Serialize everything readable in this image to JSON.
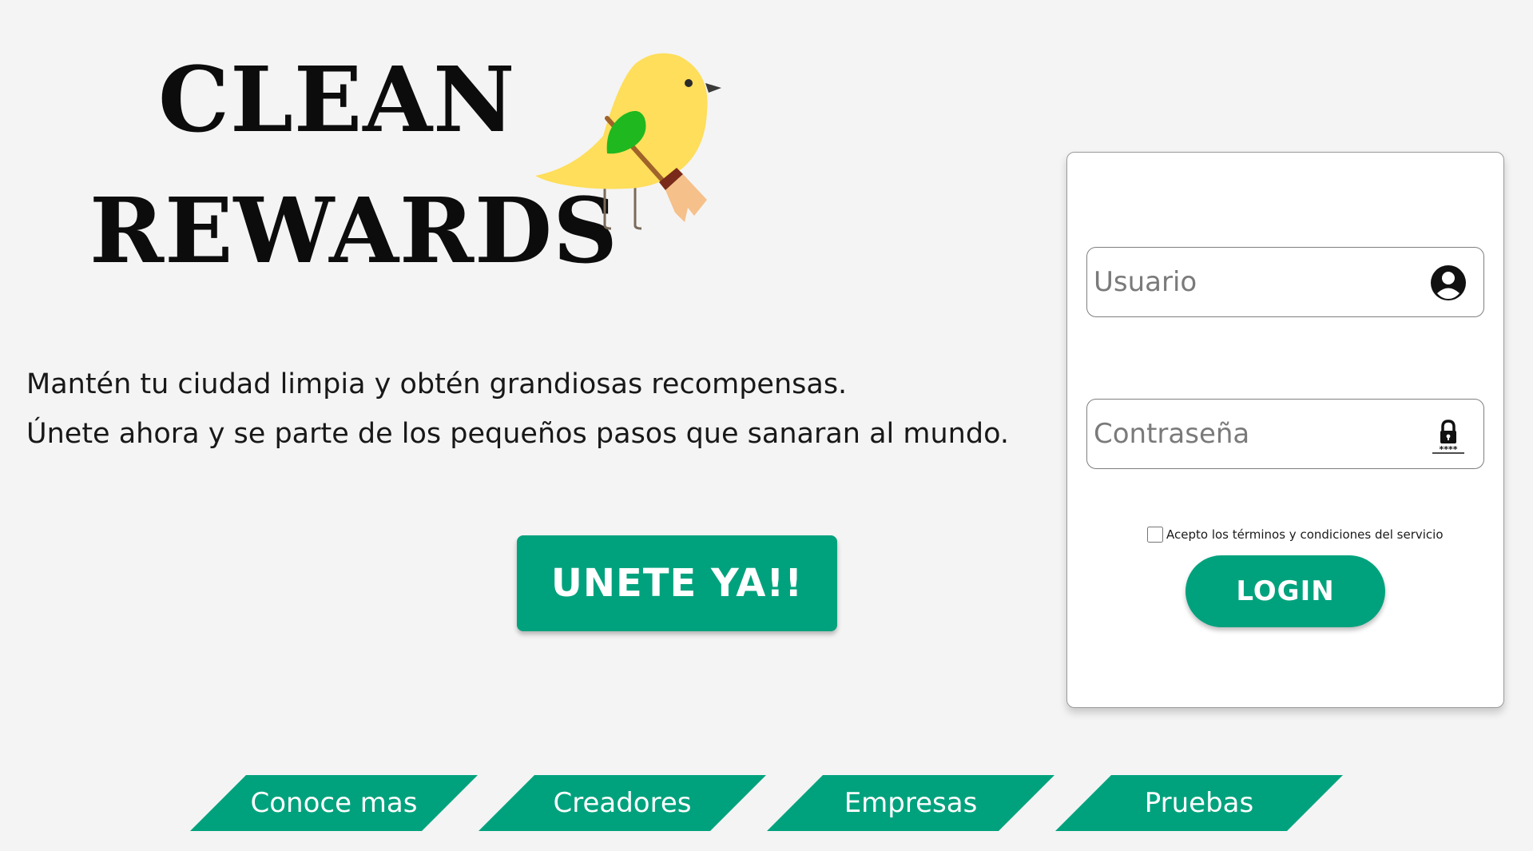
{
  "brand": {
    "title_line1": "CLEAN",
    "title_line2": "REWARDS",
    "mascot_icon": "bird-with-broom-icon"
  },
  "tagline": {
    "line1": "Mantén tu ciudad limpia y obtén grandiosas recompensas.",
    "line2": "Únete ahora y se parte de los pequeños pasos que sanaran al mundo."
  },
  "cta": {
    "join_label": "UNETE YA!!"
  },
  "login": {
    "username_placeholder": "Usuario",
    "username_value": "",
    "username_icon": "user-circle-icon",
    "password_placeholder": "Contraseña",
    "password_value": "",
    "password_icon": "lock-password-icon",
    "terms_label": "Acepto los términos y condiciones del servicio",
    "terms_checked": false,
    "login_label": "LOGIN"
  },
  "nav": {
    "items": [
      {
        "label": "Conoce mas"
      },
      {
        "label": "Creadores"
      },
      {
        "label": "Empresas"
      },
      {
        "label": "Pruebas"
      }
    ]
  },
  "colors": {
    "accent": "#00a27d",
    "background": "#f4f4f4",
    "card": "#ffffff",
    "bird_body": "#fede5a",
    "bird_wing": "#1fb81f"
  }
}
